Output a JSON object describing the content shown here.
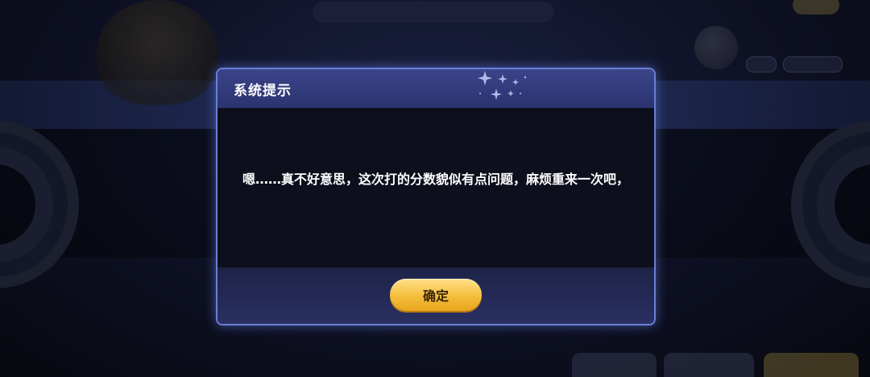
{
  "dialog": {
    "title": "系统提示",
    "message": "嗯……真不好意思，这次打的分数貌似有点问题，麻烦重来一次吧，",
    "confirm_label": "确定"
  },
  "colors": {
    "dialog_border": "#6a7fd6",
    "header_bg": "#2b3370",
    "body_bg": "#0d0f1c",
    "footer_bg": "#252b58",
    "button_gold": "#f5bd3d",
    "button_text": "#3a2508"
  }
}
